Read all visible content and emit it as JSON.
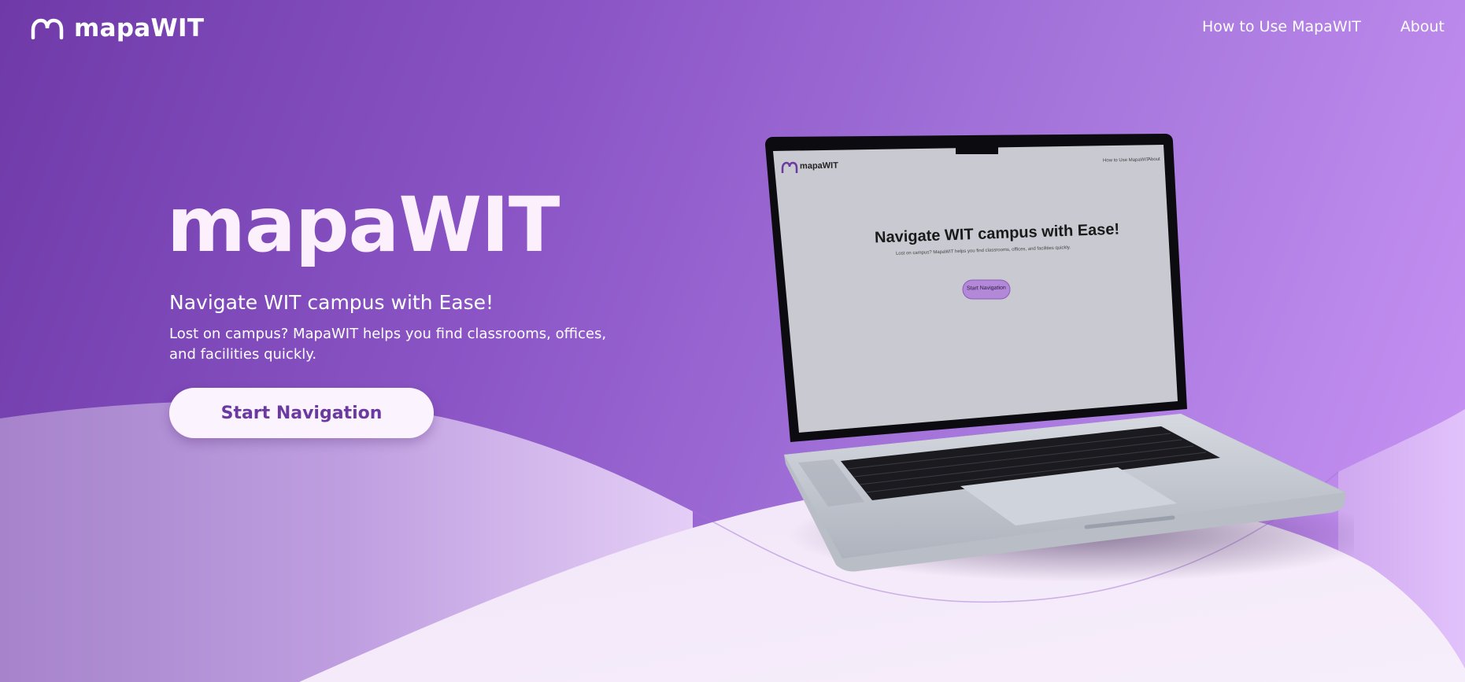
{
  "brand": {
    "name": "mapaWIT",
    "logo_icon": "arch-icon"
  },
  "nav": {
    "links": [
      {
        "label": "How to Use MapaWIT"
      },
      {
        "label": "About"
      }
    ]
  },
  "hero": {
    "title": "mapaWIT",
    "subtitle": "Navigate WIT campus with Ease!",
    "description": "Lost on campus? MapaWIT helps you find classrooms, offices, and facilities quickly.",
    "cta_label": "Start Navigation"
  },
  "laptop_screen": {
    "brand": "mapaWIT",
    "nav_links": [
      "How to Use MapaWIT",
      "About"
    ],
    "heading": "Navigate WIT campus with Ease!",
    "description": "Lost on campus? MapaWIT helps you find classrooms, offices, and facilities quickly.",
    "cta_label": "Start Navigation"
  },
  "colors": {
    "accent": "#6b3aa0",
    "background_start": "#6f3aa8",
    "background_end": "#c994f5",
    "button_bg": "#fbf3fd"
  }
}
